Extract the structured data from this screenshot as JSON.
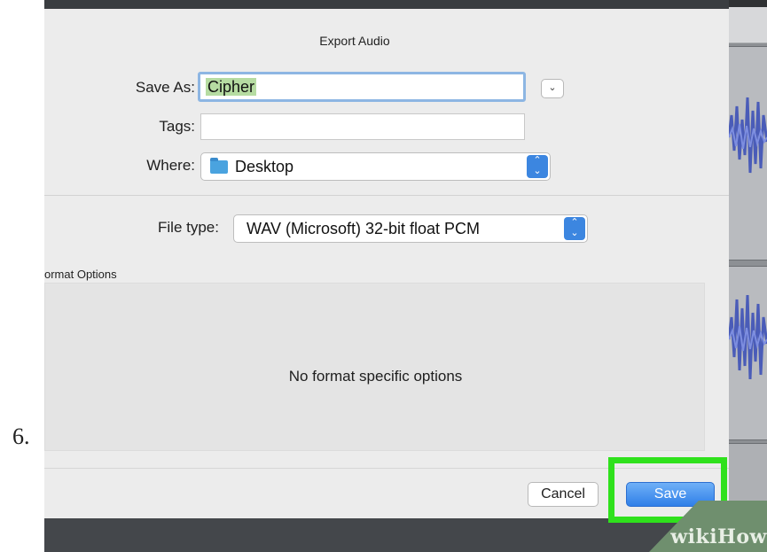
{
  "step_number": "6.",
  "dialog": {
    "title": "Export Audio",
    "save_as": {
      "label": "Save As:",
      "value": "Cipher"
    },
    "tags": {
      "label": "Tags:",
      "value": ""
    },
    "where": {
      "label": "Where:",
      "value": "Desktop",
      "icon": "folder-icon"
    },
    "file_type": {
      "label": "File type:",
      "value": "WAV (Microsoft) 32-bit float PCM"
    },
    "format_options": {
      "label": "ormat Options",
      "message": "No format specific options"
    },
    "buttons": {
      "cancel": "Cancel",
      "save": "Save"
    },
    "expand_icon": "chevron-down-icon"
  },
  "colors": {
    "highlight": "#2fe11c",
    "save_button": "#2f7fe8",
    "selection": "#b6dca2"
  },
  "watermark": {
    "prefix": "wiki",
    "suffix": "How"
  }
}
